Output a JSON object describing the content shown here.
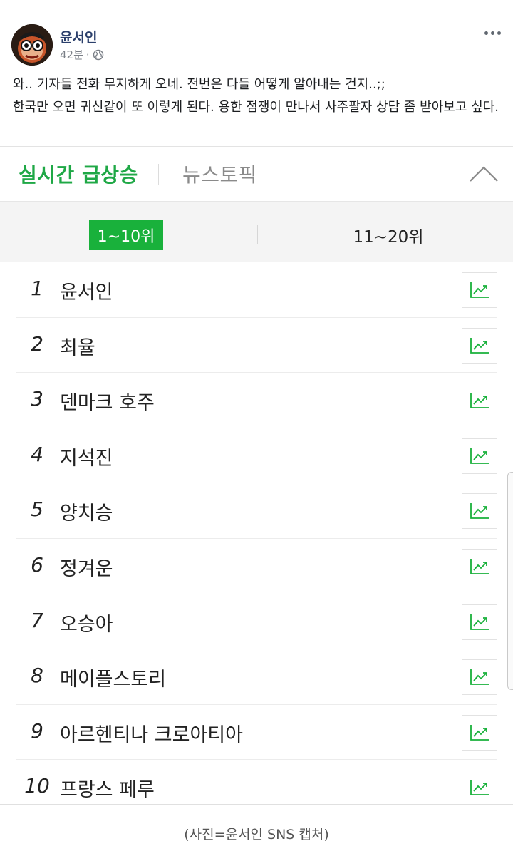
{
  "post": {
    "author": "윤서인",
    "time": "42분",
    "separator": "·",
    "lines": [
      "와.. 기자들 전화 무지하게 오네. 전번은 다들 어떻게 알아내는 건지..;;",
      "한국만 오면 귀신같이 또 이렇게 된다. 용한 점쟁이 만나서 사주팔자 상담 좀 받아보고 싶다."
    ],
    "icons": {
      "privacy": "globe-icon",
      "menu": "more-icon"
    }
  },
  "ranking": {
    "tabs": [
      {
        "label": "실시간 급상승"
      },
      {
        "label": "뉴스토픽"
      }
    ],
    "ranges": [
      {
        "label": "1~10위"
      },
      {
        "label": "11~20위"
      }
    ],
    "items": [
      {
        "rank": "1",
        "keyword": "윤서인"
      },
      {
        "rank": "2",
        "keyword": "최율"
      },
      {
        "rank": "3",
        "keyword": "덴마크 호주"
      },
      {
        "rank": "4",
        "keyword": "지석진"
      },
      {
        "rank": "5",
        "keyword": "양치승"
      },
      {
        "rank": "6",
        "keyword": "정겨운"
      },
      {
        "rank": "7",
        "keyword": "오승아"
      },
      {
        "rank": "8",
        "keyword": "메이플스토리"
      },
      {
        "rank": "9",
        "keyword": "아르헨티나 크로아티아"
      },
      {
        "rank": "10",
        "keyword": "프랑스 페루"
      }
    ],
    "colors": {
      "accent": "#19b13b",
      "active_tab": "#1fa846"
    }
  },
  "caption": "(사진=윤서인 SNS 캡처)"
}
